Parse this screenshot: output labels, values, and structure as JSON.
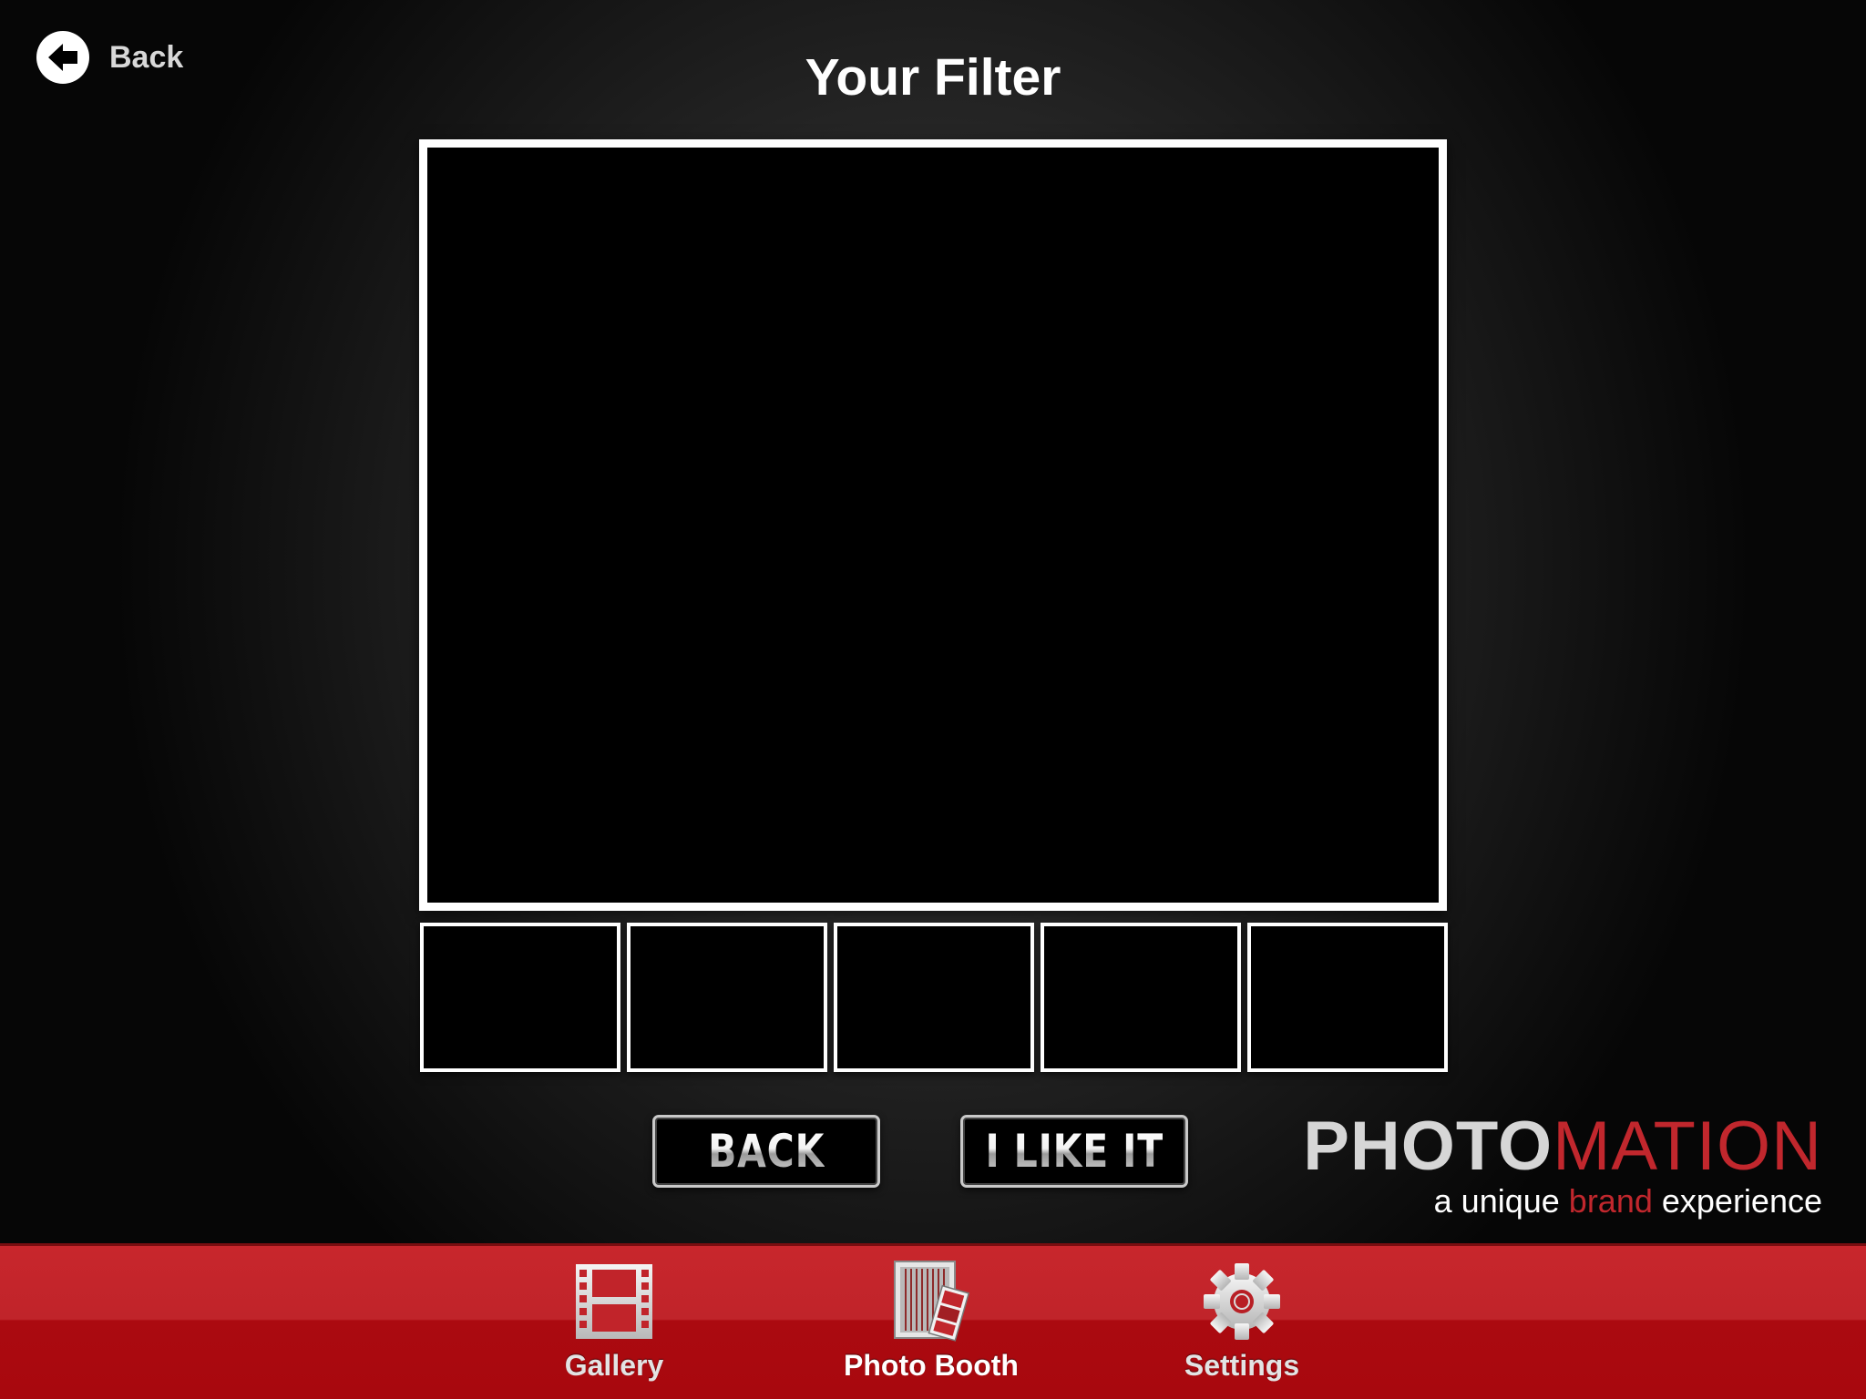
{
  "header": {
    "back_label": "Back",
    "title": "Your Filter"
  },
  "preview": {
    "thumbnail_count": 5
  },
  "actions": {
    "back_label": "BACK",
    "like_label": "I LIKE IT"
  },
  "logo": {
    "word_part1": "PHOTO",
    "word_part2": "MATION",
    "tagline_pre": "a unique ",
    "tagline_brand": "brand",
    "tagline_post": " experience",
    "accent_color": "#c1272d"
  },
  "tabbar": {
    "tabs": [
      {
        "label": "Gallery",
        "icon": "film-strip-icon",
        "active": false
      },
      {
        "label": "Photo Booth",
        "icon": "photo-booth-icon",
        "active": true
      },
      {
        "label": "Settings",
        "icon": "gear-icon",
        "active": false
      }
    ],
    "color": "#c1272d"
  }
}
